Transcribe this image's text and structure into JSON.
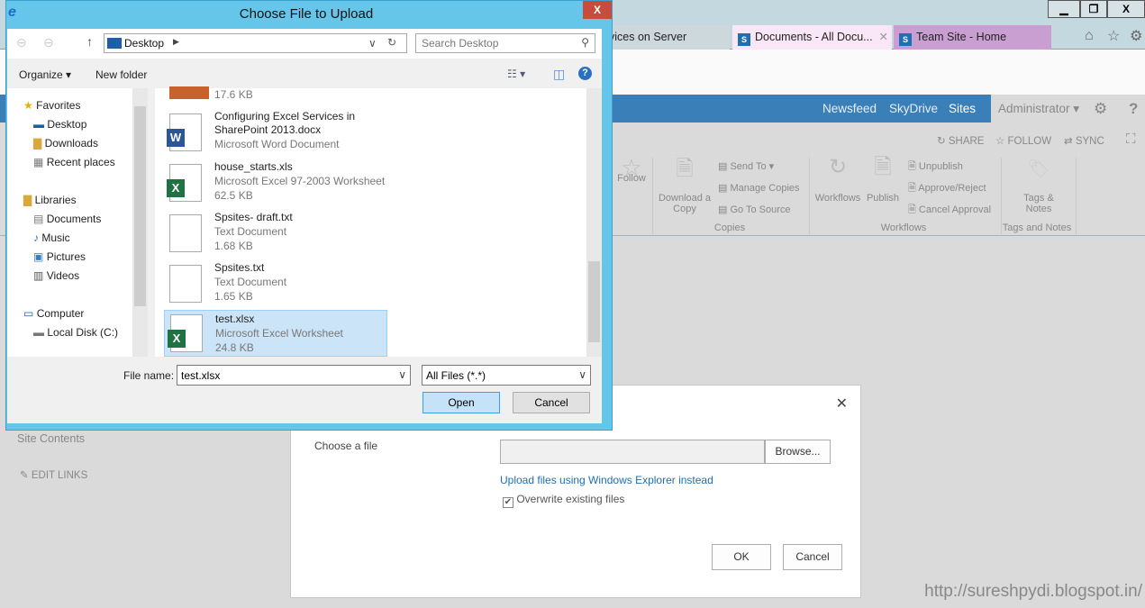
{
  "browser": {
    "tabs": [
      {
        "label": "vices on Server"
      },
      {
        "label": "Documents - All Docu..."
      },
      {
        "label": "Team Site - Home"
      }
    ],
    "window_controls": {
      "minimize": "▁",
      "restore": "❐",
      "close": "X"
    }
  },
  "suite": {
    "links": [
      "Newsfeed",
      "SkyDrive",
      "Sites"
    ],
    "user": "Administrator",
    "help": "?"
  },
  "actions": {
    "share": "SHARE",
    "follow": "FOLLOW",
    "sync": "SYNC"
  },
  "ribbon": {
    "follow": "Follow",
    "download": "Download a Copy",
    "send_to": "Send To",
    "manage_copies": "Manage Copies",
    "go_to_source": "Go To Source",
    "copies_group": "Copies",
    "workflows": "Workflows",
    "publish": "Publish",
    "unpublish": "Unpublish",
    "approve": "Approve/Reject",
    "cancel_approval": "Cancel Approval",
    "workflows_group": "Workflows",
    "tags": "Tags & Notes",
    "tags_group": "Tags and Notes"
  },
  "leftnav": {
    "site_contents": "Site Contents",
    "edit_links": "EDIT LINKS"
  },
  "file_dialog": {
    "title": "Choose File to Upload",
    "path": "Desktop",
    "search_placeholder": "Search Desktop",
    "organize": "Organize",
    "new_folder": "New folder",
    "nav": {
      "favorites": "Favorites",
      "desktop": "Desktop",
      "downloads": "Downloads",
      "recent": "Recent places",
      "libraries": "Libraries",
      "documents": "Documents",
      "music": "Music",
      "pictures": "Pictures",
      "videos": "Videos",
      "computer": "Computer",
      "local_disk": "Local Disk (C:)"
    },
    "partial_size": "17.6 KB",
    "files": [
      {
        "name": "Configuring Excel Services in SharePoint 2013.docx",
        "type": "Microsoft Word Document",
        "size": "",
        "icon": "word-icon"
      },
      {
        "name": "house_starts.xls",
        "type": "Microsoft Excel 97-2003 Worksheet",
        "size": "62.5 KB",
        "icon": "excel-icon"
      },
      {
        "name": "Spsites- draft.txt",
        "type": "Text Document",
        "size": "1.68 KB",
        "icon": "text-icon"
      },
      {
        "name": "Spsites.txt",
        "type": "Text Document",
        "size": "1.65 KB",
        "icon": "text-icon"
      },
      {
        "name": "test.xlsx",
        "type": "Microsoft Excel Worksheet",
        "size": "24.8 KB",
        "icon": "excel-icon",
        "selected": true
      }
    ],
    "file_name_label": "File name:",
    "file_name_value": "test.xlsx",
    "filter": "All Files (*.*)",
    "open": "Open",
    "cancel": "Cancel"
  },
  "upload_dialog": {
    "choose_label": "Choose a file",
    "browse": "Browse...",
    "explorer_link": "Upload files using Windows Explorer instead",
    "overwrite": "Overwrite existing files",
    "overwrite_checked": true,
    "ok": "OK",
    "cancel": "Cancel",
    "close": "✕"
  },
  "watermark": "http://sureshpydi.blogspot.in/"
}
